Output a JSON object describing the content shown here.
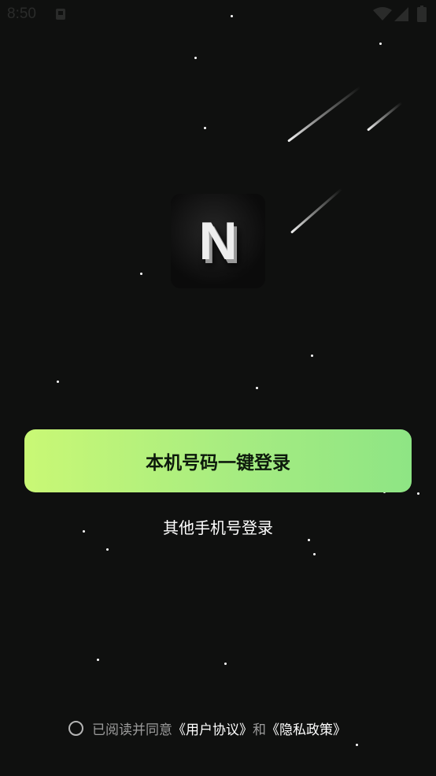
{
  "status_bar": {
    "time": "8:50",
    "icons": [
      "notification-icon",
      "wifi-icon",
      "signal-icon",
      "battery-icon"
    ]
  },
  "logo": {
    "letter": "N",
    "icon": "app-logo-icon"
  },
  "login": {
    "one_click_label": "本机号码一键登录",
    "other_phone_label": "其他手机号登录"
  },
  "agreement": {
    "checked": false,
    "prefix": "已阅读并同意",
    "user_agreement": "《用户协议》",
    "conjunction": "和",
    "privacy_policy": "《隐私政策》"
  },
  "colors": {
    "background": "#0f100f",
    "button_gradient_start": "#c9f875",
    "button_gradient_end": "#8ee584",
    "button_text": "#0d1a0c",
    "muted_text": "#9b9b9b"
  }
}
